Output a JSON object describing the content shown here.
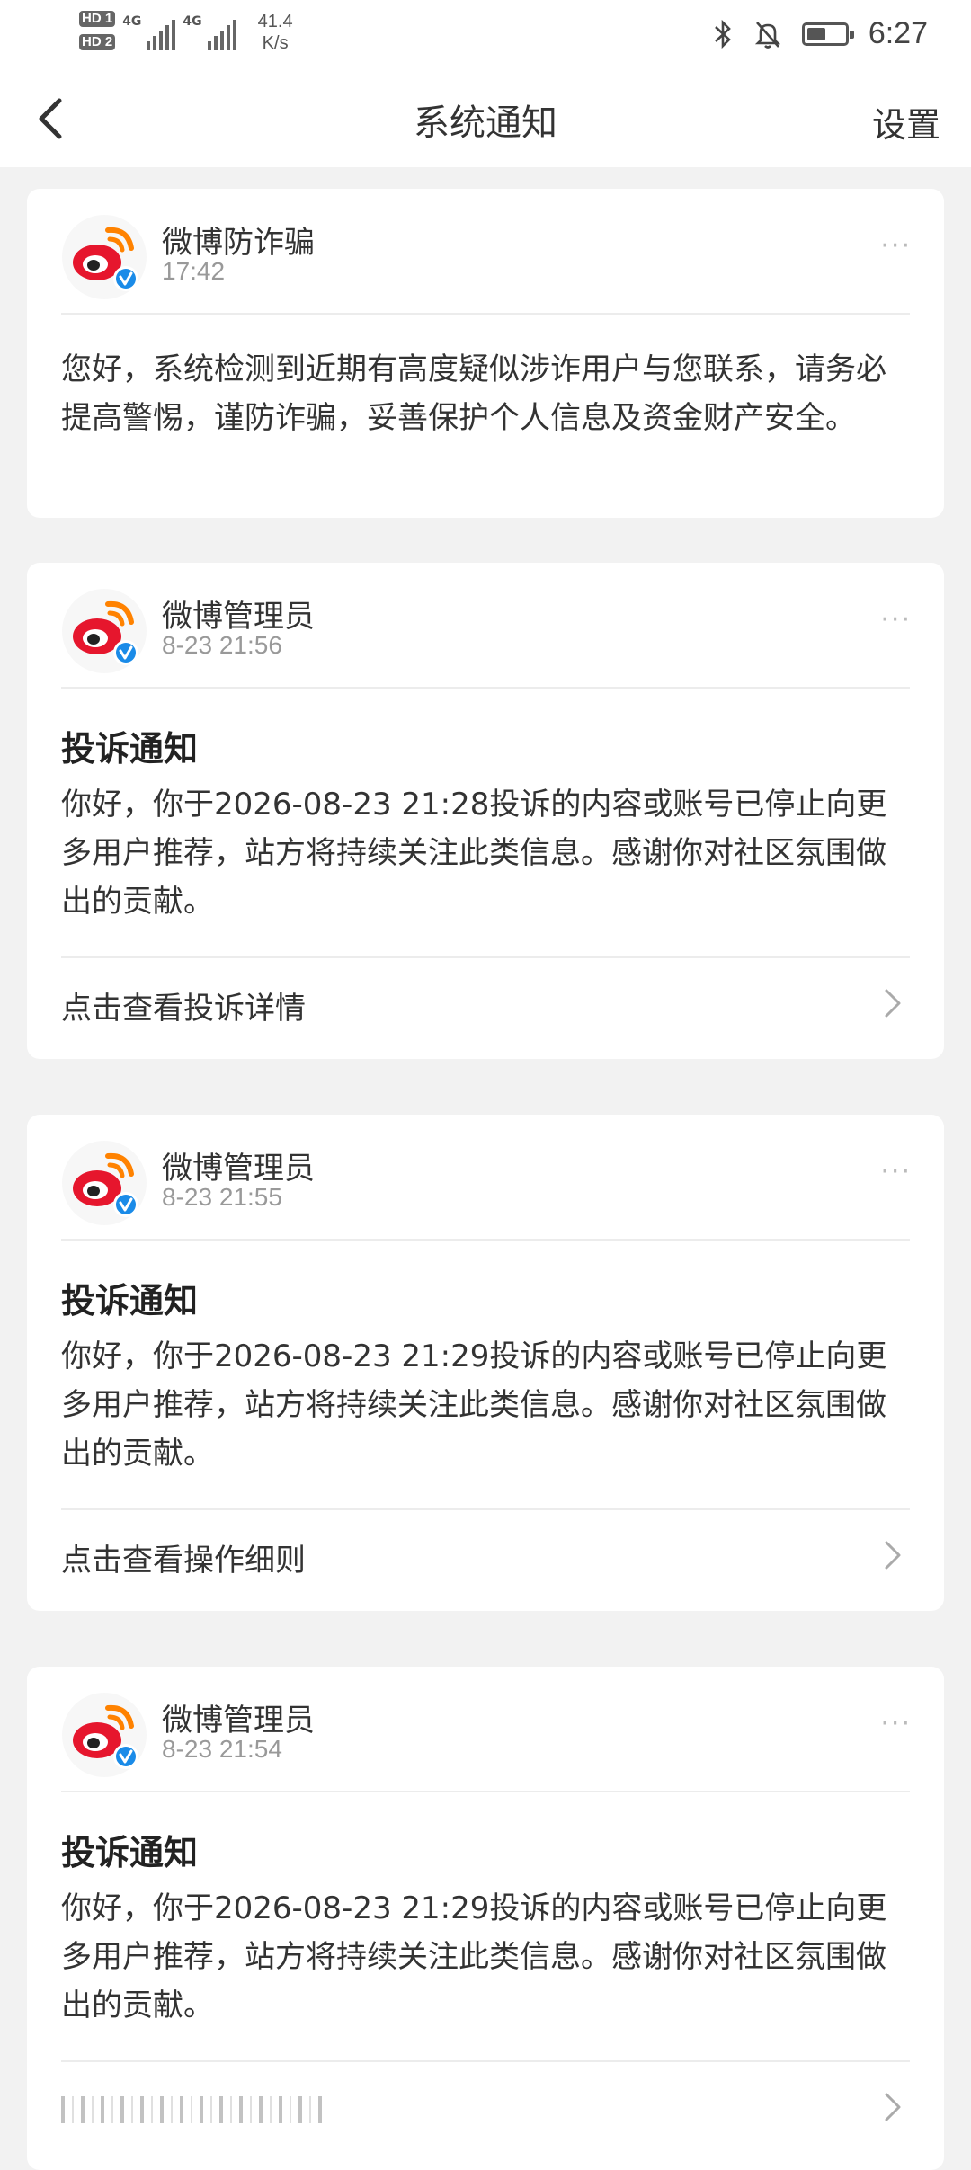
{
  "status_bar": {
    "hd1": "HD 1",
    "hd2": "HD 2",
    "net1": "4G",
    "net2": "4G",
    "speed_value": "41.4",
    "speed_unit": "K/s",
    "time": "6:27",
    "icons": [
      "bluetooth-icon",
      "mute-bell-icon",
      "battery-icon"
    ],
    "battery_level": 0.5
  },
  "nav": {
    "back_icon": "chevron-left-icon",
    "title": "系统通知",
    "settings": "设置"
  },
  "cards": [
    {
      "sender": "微博防诈骗",
      "time": "17:42",
      "more": "···",
      "body": "您好，系统检测到近期有高度疑似涉诈用户与您联系，请务必提高警惕，谨防诈骗，妥善保护个人信息及资金财产安全。"
    },
    {
      "sender": "微博管理员",
      "time": "8-23 21:56",
      "more": "···",
      "title": "投诉通知",
      "body": "你好，你于2026-08-23 21:28投诉的内容或账号已停止向更多用户推荐，站方将持续关注此类信息。感谢你对社区氛围做出的贡献。",
      "link": "点击查看投诉详情"
    },
    {
      "sender": "微博管理员",
      "time": "8-23 21:55",
      "more": "···",
      "title": "投诉通知",
      "body": "你好，你于2026-08-23 21:29投诉的内容或账号已停止向更多用户推荐，站方将持续关注此类信息。感谢你对社区氛围做出的贡献。",
      "link": "点击查看操作细则"
    },
    {
      "sender": "微博管理员",
      "time": "8-23 21:54",
      "more": "···",
      "title": "投诉通知",
      "body": "你好，你于2026-08-23 21:29投诉的内容或账号已停止向更多用户推荐，站方将持续关注此类信息。感谢你对社区氛围做出的贡献。"
    }
  ],
  "colors": {
    "background": "#f2f2f2",
    "card": "#ffffff",
    "weibo_red": "#e6162d",
    "weibo_orange": "#ff8200",
    "verified_blue": "#1a8be8"
  }
}
